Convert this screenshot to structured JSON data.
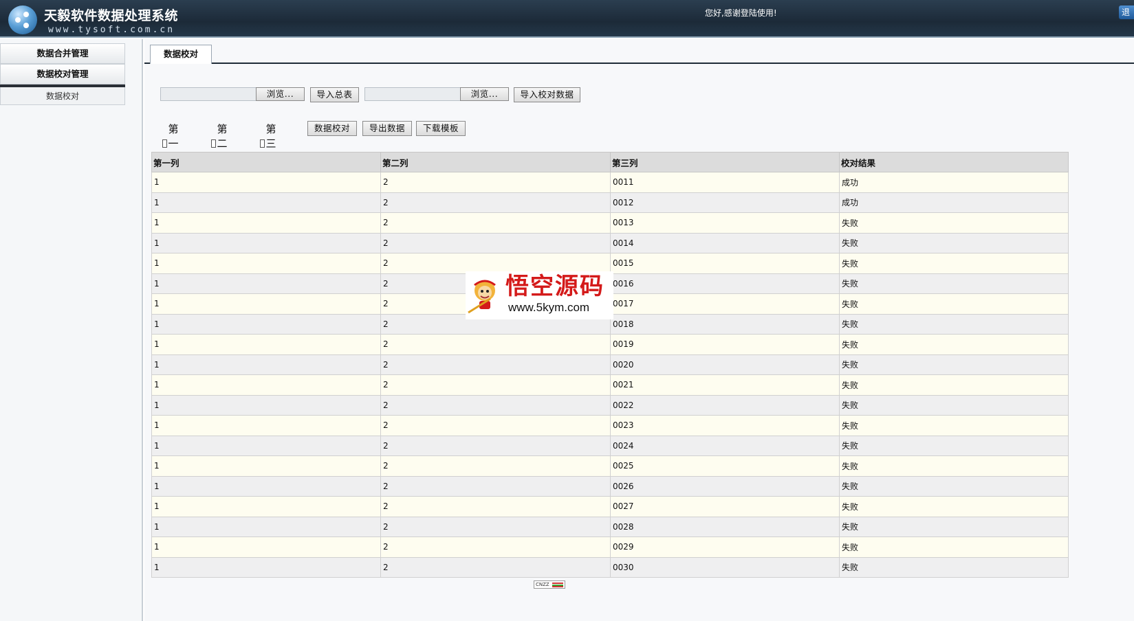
{
  "header": {
    "app_title": "天毅软件数据处理系统",
    "app_url": "www.tysoft.com.cn",
    "welcome": "您好,感谢登陆使用!",
    "logout_label": "退"
  },
  "sidebar": {
    "groups": [
      {
        "label": "数据合并管理"
      },
      {
        "label": "数据校对管理"
      }
    ],
    "sub_items": [
      {
        "label": "数据校对"
      }
    ]
  },
  "tabs": [
    {
      "label": "数据校对",
      "active": true
    }
  ],
  "toolbar": {
    "browse1_label": "浏览...",
    "import_total_label": "导入总表",
    "browse2_label": "浏览...",
    "import_check_label": "导入校对数据",
    "check_col1_label": "第一列",
    "check_col2_label": "第二列",
    "check_col3_label": "第三列",
    "check_data_label": "数据校对",
    "export_label": "导出数据",
    "download_template_label": "下载模板"
  },
  "table": {
    "columns": [
      "第一列",
      "第二列",
      "第三列",
      "校对结果"
    ],
    "rows": [
      [
        "1",
        "2",
        "0011",
        "成功"
      ],
      [
        "1",
        "2",
        "0012",
        "成功"
      ],
      [
        "1",
        "2",
        "0013",
        "失败"
      ],
      [
        "1",
        "2",
        "0014",
        "失败"
      ],
      [
        "1",
        "2",
        "0015",
        "失败"
      ],
      [
        "1",
        "2",
        "0016",
        "失败"
      ],
      [
        "1",
        "2",
        "0017",
        "失败"
      ],
      [
        "1",
        "2",
        "0018",
        "失败"
      ],
      [
        "1",
        "2",
        "0019",
        "失败"
      ],
      [
        "1",
        "2",
        "0020",
        "失败"
      ],
      [
        "1",
        "2",
        "0021",
        "失败"
      ],
      [
        "1",
        "2",
        "0022",
        "失败"
      ],
      [
        "1",
        "2",
        "0023",
        "失败"
      ],
      [
        "1",
        "2",
        "0024",
        "失败"
      ],
      [
        "1",
        "2",
        "0025",
        "失败"
      ],
      [
        "1",
        "2",
        "0026",
        "失败"
      ],
      [
        "1",
        "2",
        "0027",
        "失败"
      ],
      [
        "1",
        "2",
        "0028",
        "失败"
      ],
      [
        "1",
        "2",
        "0029",
        "失败"
      ],
      [
        "1",
        "2",
        "0030",
        "失败"
      ]
    ],
    "success_text": "成功"
  },
  "watermark": {
    "title": "悟空源码",
    "url": "www.5kym.com"
  },
  "counter": {
    "label": "CNZZ"
  },
  "colors": {
    "header_bg": "#1c2a38",
    "success": "#1b7a1b",
    "failure": "#c01010",
    "odd_row": "#fefdf0",
    "even_row": "#efeff0"
  }
}
